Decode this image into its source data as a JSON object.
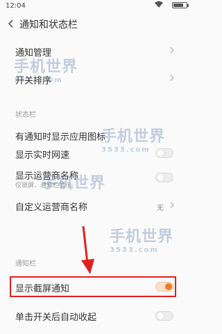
{
  "status_bar": {
    "time": "12:04"
  },
  "header": {
    "title": "通知和状态栏"
  },
  "rows": {
    "notification_manage": {
      "label": "通知管理"
    },
    "switch_order": {
      "label": "开关排序"
    },
    "show_app_icon": {
      "label": "有通知时显示应用图标",
      "on": false
    },
    "realtime_speed": {
      "label": "显示实时网速",
      "on": false
    },
    "carrier_name": {
      "label": "显示运营商名称",
      "sub": "仅锁屏、通知栏显示",
      "on": false
    },
    "custom_carrier": {
      "label": "自定义运营商名称",
      "value": "无"
    },
    "lockscreen_notify": {
      "label": "显示截屏通知",
      "on": true
    },
    "auto_collapse": {
      "label": "单击开关后自动收起",
      "on": false
    }
  },
  "sections": {
    "status_bar": "状态栏",
    "notification_bar": "通知栏"
  },
  "watermark": {
    "text": "手机世界",
    "number": "3533.com"
  },
  "colors": {
    "accent": "#f07a21",
    "highlight": "#e02020"
  }
}
